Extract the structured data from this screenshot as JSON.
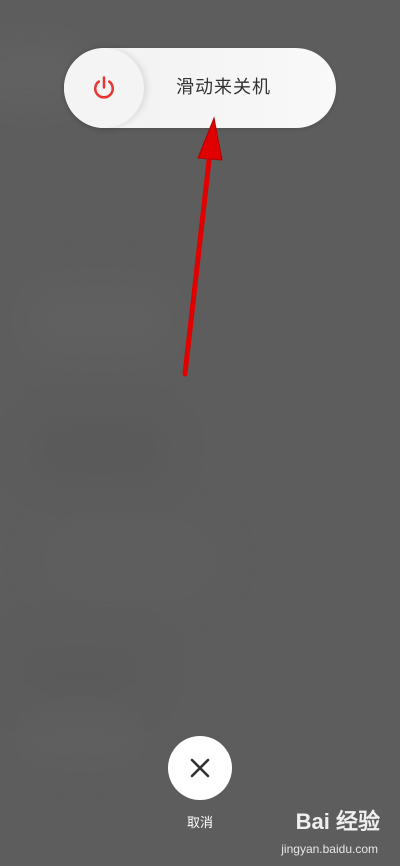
{
  "power_slider": {
    "label": "滑动来关机",
    "icon": "power-icon",
    "icon_color": "#e53935"
  },
  "cancel": {
    "label": "取消",
    "icon": "close-icon"
  },
  "annotation": {
    "arrow_color": "#e00000"
  },
  "watermark": {
    "brand": "Bai 经验",
    "url": "jingyan.baidu.com"
  }
}
